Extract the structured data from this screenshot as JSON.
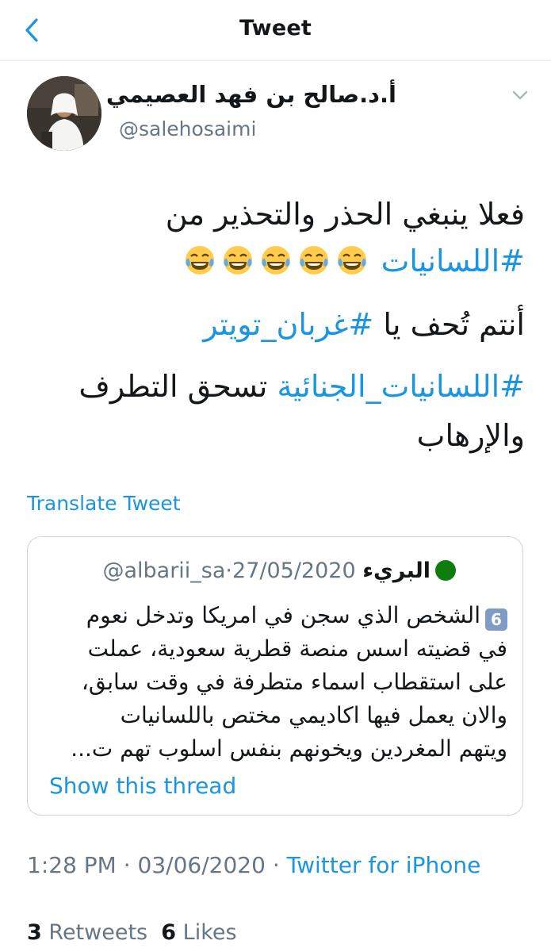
{
  "nav": {
    "title": "Tweet"
  },
  "author": {
    "display_name": "أ.د.صالح بن فهد العصيمي",
    "handle": "@salehosaimi"
  },
  "tweet": {
    "line1": "فعلا ينبغي الحذر والتحذير من",
    "hashtag1": "#اللسانيات",
    "emoji": "face-with-tears-of-joy",
    "line3_prefix": "أنتم تُحف يا",
    "hashtag2": "#غربان_تويتر",
    "hashtag3": "#اللسانيات_الجنائية",
    "line4_suffix": "تسحق التطرف",
    "line5": "والإرهاب"
  },
  "translate_label": "Translate Tweet",
  "quoted": {
    "name": "البريء",
    "handle": "@albarii_sa",
    "separator": "·",
    "date": "27/05/2020",
    "keycap": "6",
    "lines": [
      "الشخص الذي سجن في امريكا وتدخل نعوم",
      "في قضيته اسس منصة قطرية سعودية، عملت",
      "على استقطاب اسماء متطرفة في وقت سابق،",
      "والان يعمل فيها اكاديمي مختص باللسانيات",
      "ويتهم المغردين ويخونهم بنفس اسلوب تهم ت..."
    ],
    "show_thread": "Show this thread"
  },
  "meta": {
    "time": "1:28 PM",
    "dot1": "·",
    "date": "03/06/2020",
    "dot2": "·",
    "source": "Twitter for iPhone"
  },
  "stats": {
    "retweets_count": "3",
    "retweets_label": "Retweets",
    "likes_count": "6",
    "likes_label": "Likes"
  },
  "colors": {
    "link": "#1b95e0",
    "secondary": "#657786",
    "border": "#ccd6dd",
    "status_dot": "#0e7d0e"
  }
}
